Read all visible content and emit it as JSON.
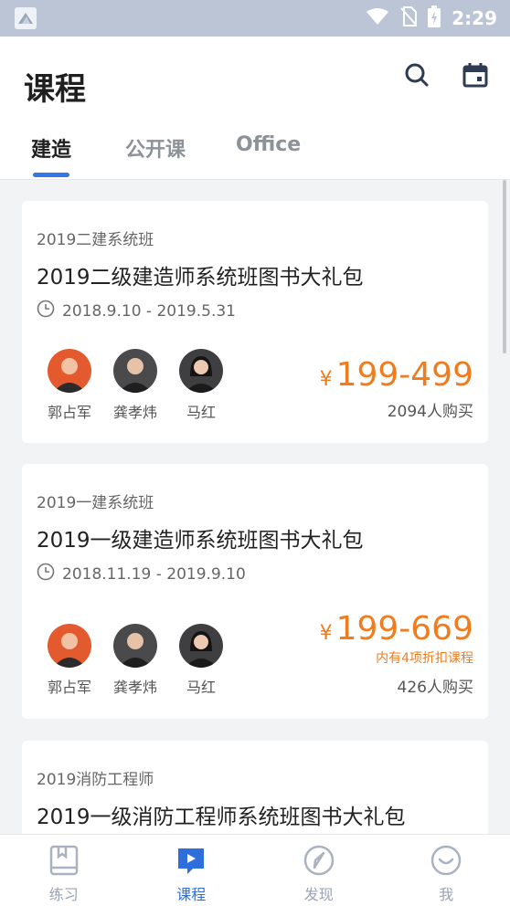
{
  "status_bar": {
    "time": "2:29"
  },
  "header": {
    "title": "课程"
  },
  "tabs": [
    {
      "label": "建造"
    },
    {
      "label": "公开课"
    },
    {
      "label": "Office"
    }
  ],
  "courses": [
    {
      "category": "2019二建系统班",
      "title": "2019二级建造师系统班图书大礼包",
      "date_range": "2018.9.10 - 2019.5.31",
      "teachers": [
        {
          "name": "郭占军"
        },
        {
          "name": "龚孝炜"
        },
        {
          "name": "马红"
        }
      ],
      "currency": "¥",
      "price": "199-499",
      "discount": "",
      "buyers": "2094人购买"
    },
    {
      "category": "2019一建系统班",
      "title": "2019一级建造师系统班图书大礼包",
      "date_range": "2018.11.19 - 2019.9.10",
      "teachers": [
        {
          "name": "郭占军"
        },
        {
          "name": "龚孝炜"
        },
        {
          "name": "马红"
        }
      ],
      "currency": "¥",
      "price": "199-669",
      "discount": "内有4项折扣课程",
      "buyers": "426人购买"
    },
    {
      "category": "2019消防工程师",
      "title": "2019一级消防工程师系统班图书大礼包"
    }
  ],
  "bottom_nav": [
    {
      "label": "练习",
      "icon": "book-icon"
    },
    {
      "label": "课程",
      "icon": "play-icon"
    },
    {
      "label": "发现",
      "icon": "compass-icon"
    },
    {
      "label": "我",
      "icon": "smile-icon"
    }
  ],
  "colors": {
    "accent": "#3477e8",
    "price": "#f07c1e",
    "status_bar": "#bcc5d6"
  }
}
